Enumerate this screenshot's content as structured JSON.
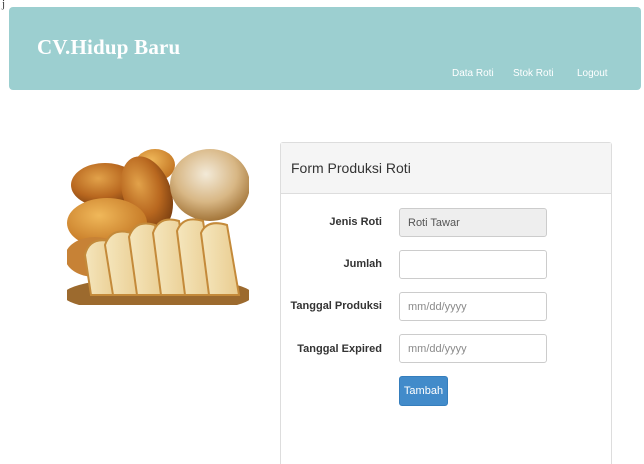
{
  "corner_mark": "j",
  "brand": {
    "name": "CV.Hidup Baru"
  },
  "nav": {
    "items": [
      {
        "label": "Data Roti"
      },
      {
        "label": "Stok Roti"
      },
      {
        "label": "Logout"
      }
    ]
  },
  "colors": {
    "navbar": "#9ccfd0",
    "primary_button": "#428bca"
  },
  "panel": {
    "title": "Form Produksi Roti"
  },
  "form": {
    "jenis_roti": {
      "label": "Jenis Roti",
      "value": "Roti Tawar"
    },
    "jumlah": {
      "label": "Jumlah",
      "value": ""
    },
    "tanggal_produksi": {
      "label": "Tanggal Produksi",
      "placeholder": "mm/dd/yyyy"
    },
    "tanggal_expired": {
      "label": "Tanggal Expired",
      "placeholder": "mm/dd/yyyy"
    },
    "submit_label": "Tambah"
  }
}
